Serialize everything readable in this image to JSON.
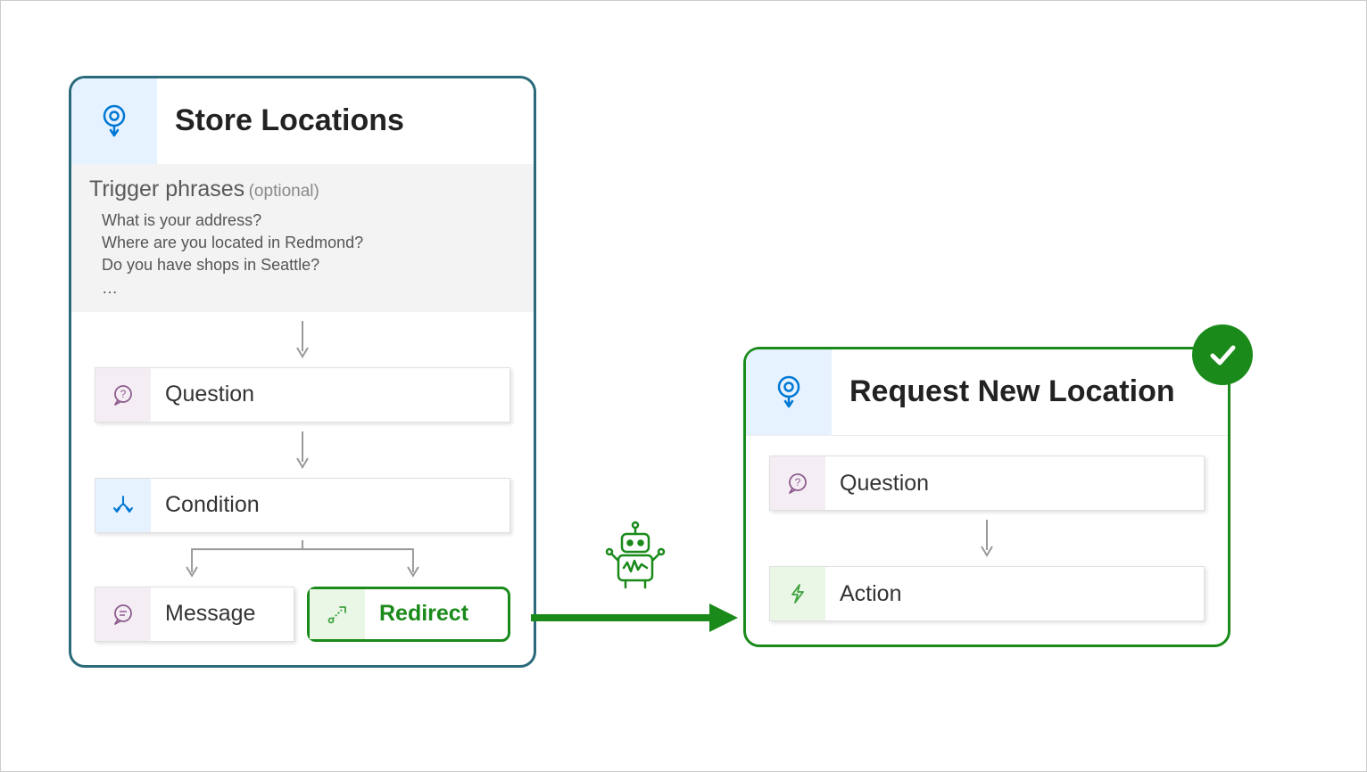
{
  "left_card": {
    "title": "Store Locations",
    "trigger": {
      "label": "Trigger phrases",
      "optional": "(optional)",
      "phrases": [
        "What is your address?",
        "Where are you located in Redmond?",
        "Do you have shops in Seattle?",
        "…"
      ]
    },
    "nodes": {
      "question": "Question",
      "condition": "Condition",
      "message": "Message",
      "redirect": "Redirect"
    }
  },
  "right_card": {
    "title": "Request New Location",
    "nodes": {
      "question": "Question",
      "action": "Action"
    }
  },
  "icons": {
    "topic": "topic-icon",
    "question": "question-bubble-icon",
    "condition": "branch-icon",
    "message": "chat-bubble-icon",
    "redirect": "route-icon",
    "action": "lightning-icon",
    "bot": "bot-icon",
    "check": "checkmark-icon"
  },
  "colors": {
    "teal_border": "#2a6a7a",
    "green": "#1a8a1a",
    "blue": "#0078d4"
  }
}
